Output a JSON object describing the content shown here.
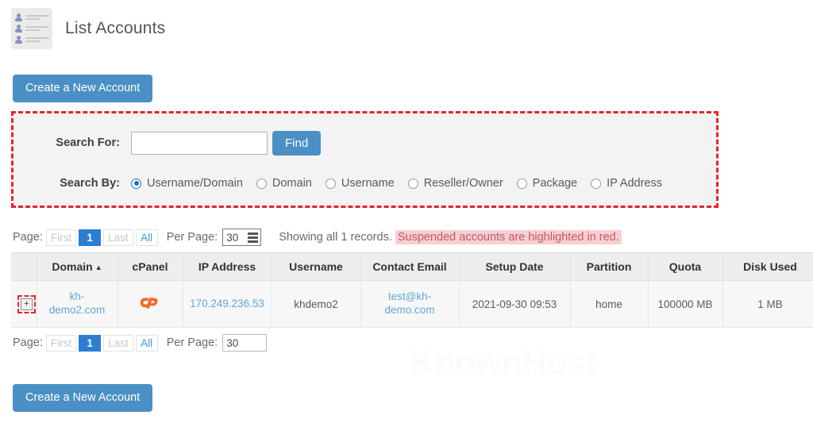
{
  "header": {
    "title": "List Accounts",
    "icon": "accounts-list-icon"
  },
  "actions": {
    "create_top_label": "Create a New Account",
    "create_bottom_label": "Create a New Account"
  },
  "search": {
    "search_for_label": "Search For:",
    "search_for_value": "",
    "search_for_placeholder": "",
    "find_label": "Find",
    "search_by_label": "Search By:",
    "options": [
      {
        "label": "Username/Domain",
        "checked": true
      },
      {
        "label": "Domain",
        "checked": false
      },
      {
        "label": "Username",
        "checked": false
      },
      {
        "label": "Reseller/Owner",
        "checked": false
      },
      {
        "label": "Package",
        "checked": false
      },
      {
        "label": "IP Address",
        "checked": false
      }
    ],
    "highlight_color": "#e8232a"
  },
  "pager_top": {
    "page_label": "Page:",
    "first_label": "First",
    "current_page": "1",
    "last_label": "Last",
    "all_label": "All",
    "per_page_label": "Per Page:",
    "per_page_value": "30",
    "showing_text": "Showing all 1 records.",
    "suspended_note": "Suspended accounts are highlighted in red."
  },
  "pager_bottom": {
    "page_label": "Page:",
    "first_label": "First",
    "current_page": "1",
    "last_label": "Last",
    "all_label": "All",
    "per_page_label": "Per Page:",
    "per_page_value": "30"
  },
  "table": {
    "columns": [
      "Domain",
      "cPanel",
      "IP Address",
      "Username",
      "Contact Email",
      "Setup Date",
      "Partition",
      "Quota",
      "Disk Used"
    ],
    "sort_column": "Domain",
    "sort_arrow": "▲",
    "expander_symbol": "+",
    "rows": [
      {
        "domain": "kh-demo2.com",
        "cpanel_icon": "cpanel-logo-icon",
        "ip_address": "170.249.236.53",
        "username": "khdemo2",
        "contact_email": "test@kh-demo.com",
        "setup_date": "2021-09-30 09:53",
        "partition": "home",
        "quota": "100000 MB",
        "disk_used": "1 MB"
      }
    ]
  },
  "watermark": {
    "text": "KnownHost"
  }
}
